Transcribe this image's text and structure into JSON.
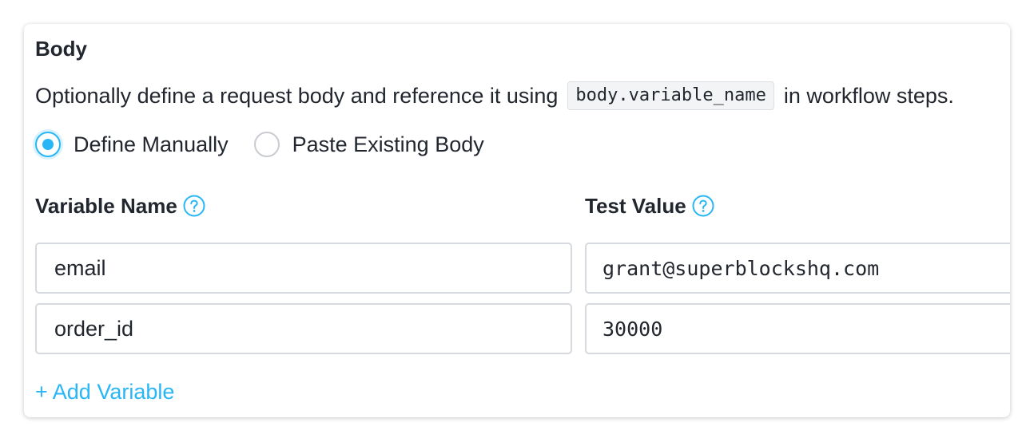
{
  "body_section": {
    "title": "Body",
    "description_before": "Optionally define a request body and reference it using",
    "description_code": "body.variable_name",
    "description_after": "in workflow steps.",
    "radio_options": [
      {
        "label": "Define Manually",
        "selected": true
      },
      {
        "label": "Paste Existing Body",
        "selected": false
      }
    ],
    "columns": {
      "variable_name": "Variable Name",
      "test_value": "Test Value"
    },
    "rows": [
      {
        "variable_name": "email",
        "test_value": "grant@superblockshq.com"
      },
      {
        "variable_name": "order_id",
        "test_value": "30000"
      }
    ],
    "add_variable_label": "+ Add Variable"
  },
  "icons": {
    "help": "question-circle-icon",
    "radio_selected": "radio-selected-icon",
    "radio_unselected": "radio-unselected-icon"
  },
  "colors": {
    "accent": "#29b6f6",
    "text": "#22262e",
    "border": "#d6d9dd"
  }
}
